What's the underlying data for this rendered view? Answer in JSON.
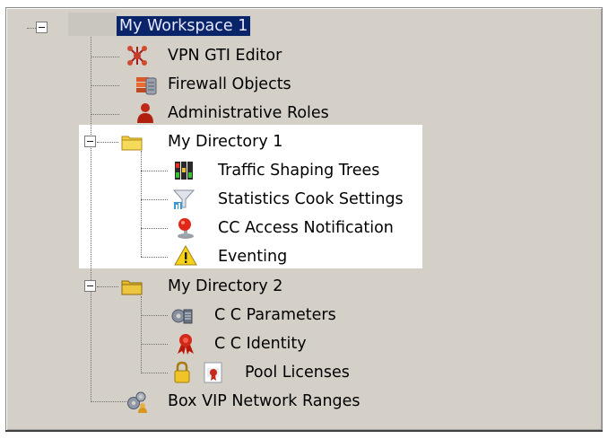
{
  "tree": {
    "root": {
      "label": "My Workspace 1",
      "expander": "collapse"
    },
    "items": [
      {
        "label": "VPN GTI Editor",
        "icon": "vpn-network-icon"
      },
      {
        "label": "Firewall Objects",
        "icon": "firewall-objects-icon"
      },
      {
        "label": "Administrative Roles",
        "icon": "admin-user-icon"
      },
      {
        "label": "My Directory 1",
        "icon": "folder-icon",
        "expander": "collapse",
        "children": [
          {
            "label": "Traffic Shaping Trees",
            "icon": "traffic-light-icon"
          },
          {
            "label": "Statistics Cook Settings",
            "icon": "funnel-chart-icon"
          },
          {
            "label": "CC Access Notification",
            "icon": "red-alert-pin-icon"
          },
          {
            "label": "Eventing",
            "icon": "warning-triangle-icon"
          }
        ]
      },
      {
        "label": "My Directory 2",
        "icon": "folder-icon",
        "expander": "collapse",
        "children": [
          {
            "label": "C C Parameters",
            "icon": "gear-list-icon"
          },
          {
            "label": "C C Identity",
            "icon": "ribbon-badge-icon"
          },
          {
            "label": "Pool Licenses",
            "icon": "lock-icon",
            "icon2": "license-certificate-icon"
          }
        ]
      },
      {
        "label": "Box VIP Network Ranges",
        "icon": "gears-user-icon"
      }
    ]
  },
  "colors": {
    "panel_bg": "#d4d0c8",
    "selection_bg": "#0a246a",
    "highlight_bg": "#ffffff"
  }
}
